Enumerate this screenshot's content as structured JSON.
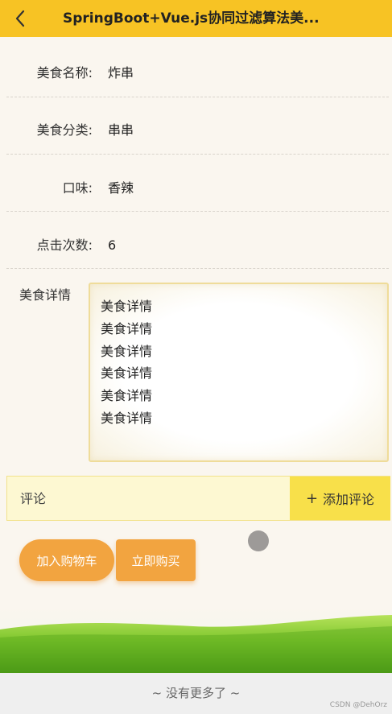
{
  "header": {
    "title": "SpringBoot+Vue.js协同过滤算法美..."
  },
  "fields": [
    {
      "label": "美食名称:",
      "value": "炸串"
    },
    {
      "label": "美食分类:",
      "value": "串串"
    },
    {
      "label": "口味:",
      "value": "香辣"
    },
    {
      "label": "点击次数:",
      "value": "6"
    }
  ],
  "detail": {
    "label": "美食详情",
    "lines": [
      "美食详情",
      "美食详情",
      "美食详情",
      "美食详情",
      "美食详情",
      "美食详情"
    ]
  },
  "comment": {
    "placeholder": "评论",
    "add_label": "添加评论"
  },
  "actions": {
    "cart_label": "加入购物车",
    "buy_label": "立即购买"
  },
  "footer": {
    "no_more": "~ 没有更多了 ~",
    "watermark": "CSDN @DehOrz"
  },
  "colors": {
    "header": "#f7c324",
    "accent": "#f2a440",
    "add_comment_bg": "#f8e04a"
  }
}
